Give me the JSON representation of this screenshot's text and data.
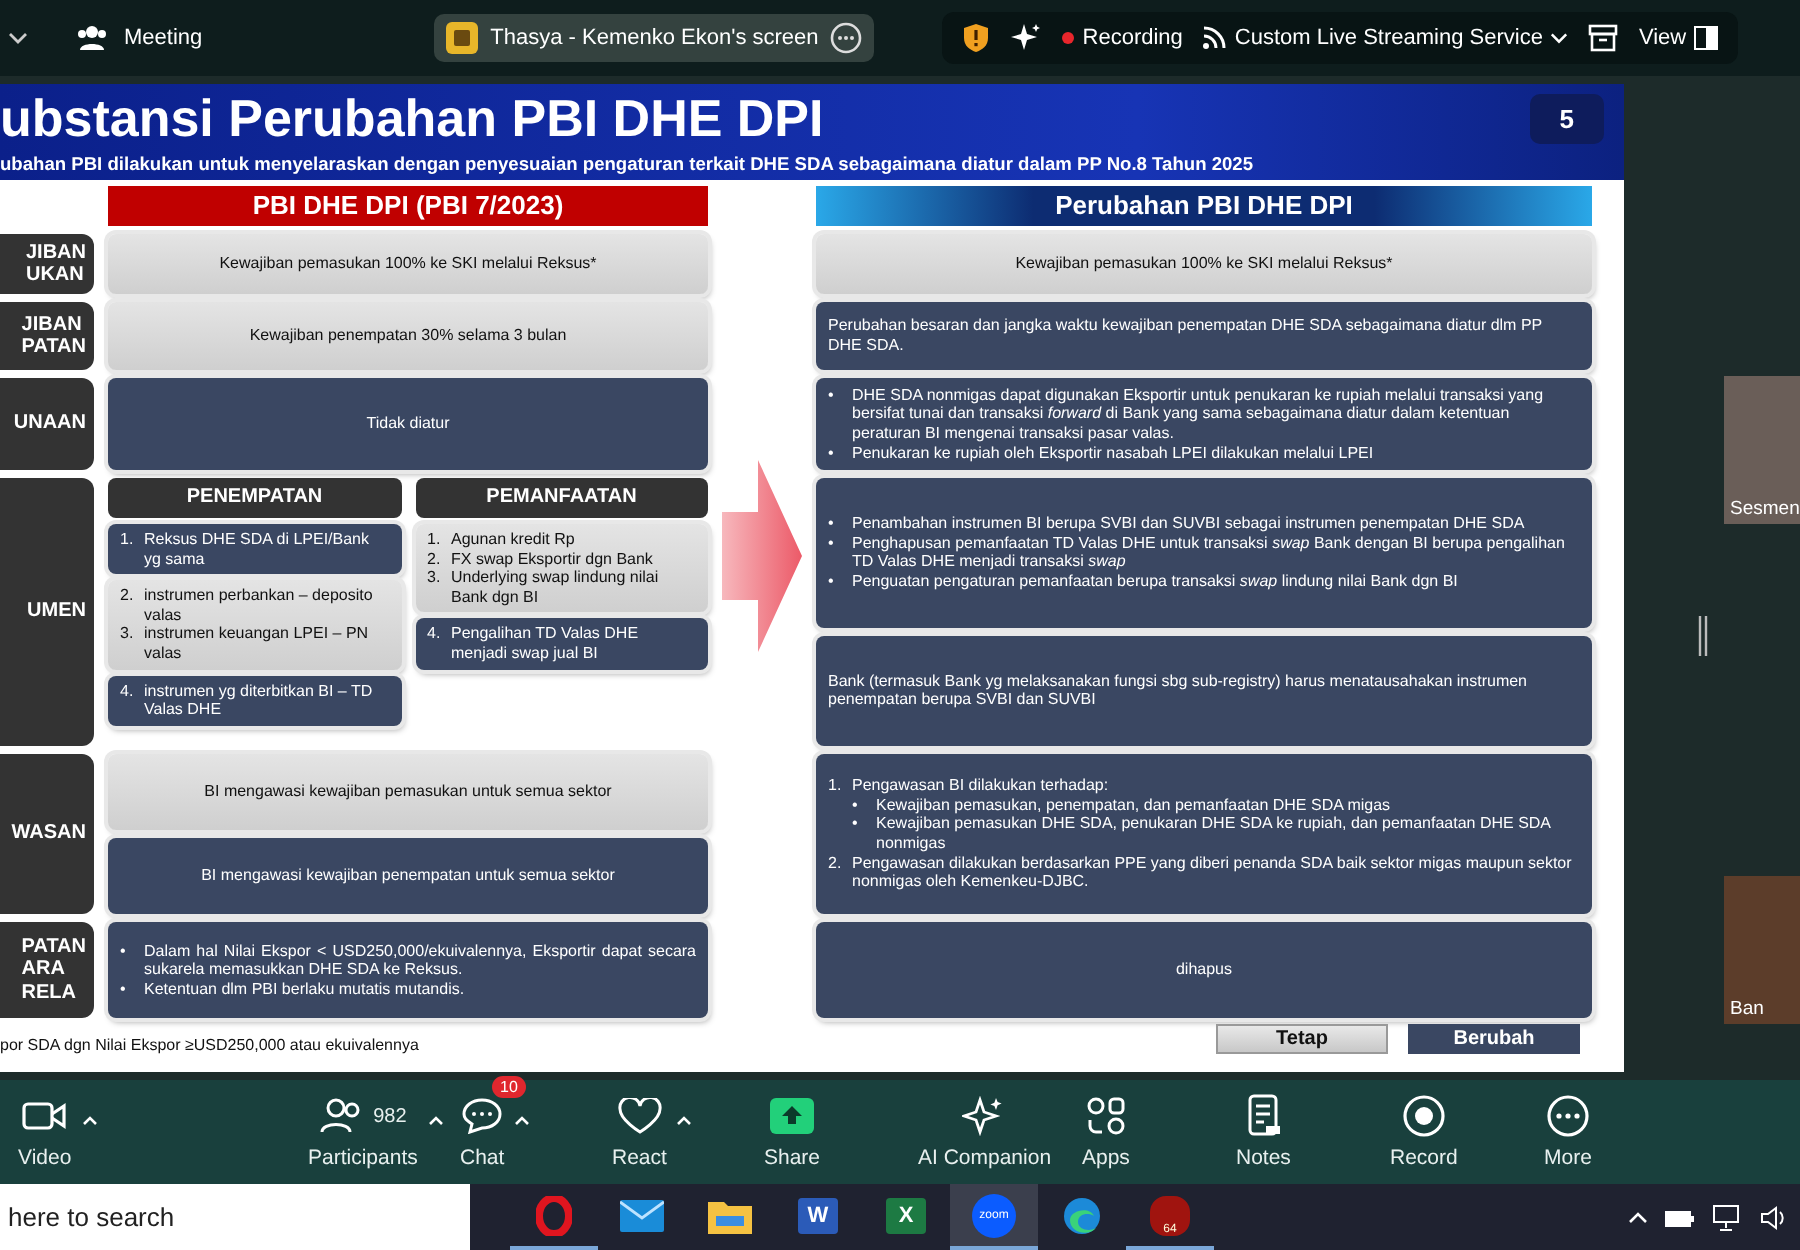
{
  "top_bar": {
    "meeting": "Meeting",
    "shared_screen": "Thasya - Kemenko Ekon's screen",
    "recording": "Recording",
    "streaming": "Custom Live Streaming Service",
    "view": "View"
  },
  "slide": {
    "title": "ubstansi Perubahan PBI DHE DPI",
    "subtitle": "ubahan PBI dilakukan untuk menyelaraskan dengan penyesuaian pengaturan terkait DHE SDA sebagaimana diatur dalam PP No.8 Tahun 2025",
    "page_number": "5",
    "left_header": "PBI DHE DPI (PBI 7/2023)",
    "right_header": "Perubahan PBI DHE DPI",
    "rows": [
      {
        "label": "JIBAN\nUKAN",
        "left": [
          {
            "kind": "tetap",
            "text": "Kewajiban pemasukan 100% ke SKI melalui Reksus*"
          }
        ],
        "right": [
          {
            "kind": "tetap",
            "text": "Kewajiban pemasukan 100% ke SKI melalui Reksus*"
          }
        ]
      },
      {
        "label": "JIBAN\nPATAN",
        "left": [
          {
            "kind": "tetap",
            "text": "Kewajiban penempatan 30% selama 3 bulan"
          }
        ],
        "right": [
          {
            "kind": "berubah",
            "paragraph": "Perubahan besaran dan jangka waktu kewajiban penempatan DHE SDA sebagaimana diatur dlm PP DHE SDA."
          }
        ]
      },
      {
        "label": "UNAAN",
        "left": [
          {
            "kind": "berubah",
            "text": "Tidak diatur"
          }
        ],
        "right": [
          {
            "kind": "berubah",
            "items": [
              {
                "marker": "•",
                "text": "DHE SDA nonmigas dapat digunakan Eksportir untuk penukaran ke rupiah melalui transaksi yang bersifat tunai dan transaksi *forward* di Bank yang sama sebagaimana diatur dalam ketentuan peraturan BI mengenai transaksi pasar valas."
              },
              {
                "marker": "•",
                "text": "Penukaran ke rupiah oleh Eksportir nasabah LPEI dilakukan melalui LPEI"
              }
            ]
          }
        ]
      },
      {
        "label": "UMEN",
        "left_columns": [
          {
            "header": "PENEMPATAN",
            "boxes": [
              {
                "kind": "berubah",
                "items": [
                  {
                    "marker": "1.",
                    "text": "Reksus DHE SDA di LPEI/Bank yg sama"
                  }
                ]
              },
              {
                "kind": "tetap",
                "items": [
                  {
                    "marker": "2.",
                    "text": "instrumen perbankan – deposito valas"
                  },
                  {
                    "marker": "3.",
                    "text": "instrumen keuangan LPEI – PN valas"
                  }
                ]
              },
              {
                "kind": "berubah",
                "items": [
                  {
                    "marker": "4.",
                    "text": "instrumen yg diterbitkan BI – TD Valas DHE"
                  }
                ]
              }
            ]
          },
          {
            "header": "PEMANFAATAN",
            "boxes": [
              {
                "kind": "tetap",
                "items": [
                  {
                    "marker": "1.",
                    "text": "Agunan kredit Rp"
                  },
                  {
                    "marker": "2.",
                    "text": "FX swap Eksportir dgn Bank"
                  },
                  {
                    "marker": "3.",
                    "text": "Underlying swap lindung nilai Bank dgn BI"
                  }
                ]
              },
              {
                "kind": "berubah",
                "items": [
                  {
                    "marker": "4.",
                    "text": "Pengalihan TD Valas DHE menjadi swap jual BI"
                  }
                ]
              }
            ]
          }
        ],
        "right": [
          {
            "kind": "berubah",
            "items": [
              {
                "marker": "•",
                "text": "Penambahan instrumen BI berupa SVBI dan SUVBI sebagai instrumen penempatan DHE SDA"
              },
              {
                "marker": "•",
                "text": "Penghapusan pemanfaatan TD Valas DHE untuk transaksi *swap* Bank dengan BI berupa pengalihan TD Valas DHE menjadi transaksi *swap*"
              },
              {
                "marker": "•",
                "text": "Penguatan pengaturan pemanfaatan berupa transaksi *swap* lindung nilai Bank dgn BI"
              }
            ]
          },
          {
            "kind": "berubah",
            "paragraph": "Bank (termasuk Bank yg melaksanakan fungsi sbg sub-registry) harus menatausahakan instrumen penempatan berupa SVBI dan SUVBI"
          }
        ]
      },
      {
        "label": "WASAN",
        "left": [
          {
            "kind": "tetap",
            "text": "BI mengawasi kewajiban pemasukan untuk semua sektor"
          },
          {
            "kind": "berubah",
            "text": "BI mengawasi kewajiban penempatan untuk semua sektor"
          }
        ],
        "right": [
          {
            "kind": "berubah",
            "items": [
              {
                "marker": "1.",
                "text": "Pengawasan BI dilakukan terhadap:",
                "children": [
                  {
                    "marker": "•",
                    "text": "Kewajiban pemasukan, penempatan, dan pemanfaatan DHE SDA migas"
                  },
                  {
                    "marker": "•",
                    "text": "Kewajiban pemasukan DHE SDA, penukaran DHE SDA ke rupiah, dan pemanfaatan DHE SDA nonmigas"
                  }
                ]
              },
              {
                "marker": "2.",
                "text": "Pengawasan dilakukan berdasarkan PPE yang diberi penanda SDA baik sektor migas maupun sektor nonmigas oleh Kemenkeu-DJBC."
              }
            ]
          }
        ]
      },
      {
        "label": "PATAN\nARA\nRELA",
        "left": [
          {
            "kind": "berubah",
            "items": [
              {
                "marker": "•",
                "text": "Dalam hal Nilai Ekspor < USD250,000/ekuivalennya, Eksportir dapat secara sukarela memasukkan DHE SDA ke Reksus."
              },
              {
                "marker": "•",
                "text": "Ketentuan dlm PBI berlaku mutatis mutandis."
              }
            ]
          }
        ],
        "right": [
          {
            "kind": "berubah",
            "text": "dihapus"
          }
        ]
      }
    ],
    "footnote": "por SDA dgn Nilai Ekspor ≥USD250,000 atau ekuivalennya",
    "legend": [
      {
        "kind": "tetap",
        "label": "Tetap"
      },
      {
        "kind": "berubah",
        "label": "Berubah"
      }
    ]
  },
  "participants": [
    {
      "name": "Sesmen"
    },
    {
      "name": "Ban"
    }
  ],
  "toolbar": [
    {
      "kind": "video",
      "label": "Video",
      "menu": true
    },
    {
      "kind": "participants",
      "label": "Participants",
      "count": "982",
      "menu": true
    },
    {
      "kind": "chat",
      "label": "Chat",
      "badge": "10",
      "menu": true
    },
    {
      "kind": "react",
      "label": "React",
      "menu": true
    },
    {
      "kind": "share",
      "label": "Share",
      "menu": false
    },
    {
      "kind": "ai",
      "label": "AI Companion",
      "menu": false
    },
    {
      "kind": "apps",
      "label": "Apps",
      "menu": false
    },
    {
      "kind": "notes",
      "label": "Notes",
      "menu": false
    },
    {
      "kind": "record",
      "label": "Record",
      "menu": false
    },
    {
      "kind": "more",
      "label": "More",
      "menu": false
    }
  ],
  "taskbar": {
    "search": {
      "placeholder": "here to search"
    },
    "apps": [
      {
        "kind": "opera",
        "running": true,
        "selected": false
      },
      {
        "kind": "mail",
        "running": false,
        "selected": false
      },
      {
        "kind": "folder",
        "running": false,
        "selected": false
      },
      {
        "kind": "word",
        "glyph": "W",
        "running": false,
        "selected": false
      },
      {
        "kind": "excel",
        "glyph": "X",
        "running": false,
        "selected": false
      },
      {
        "kind": "zoom",
        "glyph": "zoom",
        "running": true,
        "selected": true
      },
      {
        "kind": "edge",
        "running": false,
        "selected": false
      },
      {
        "kind": "game",
        "glyph": "64",
        "running": true,
        "selected": false
      }
    ]
  }
}
